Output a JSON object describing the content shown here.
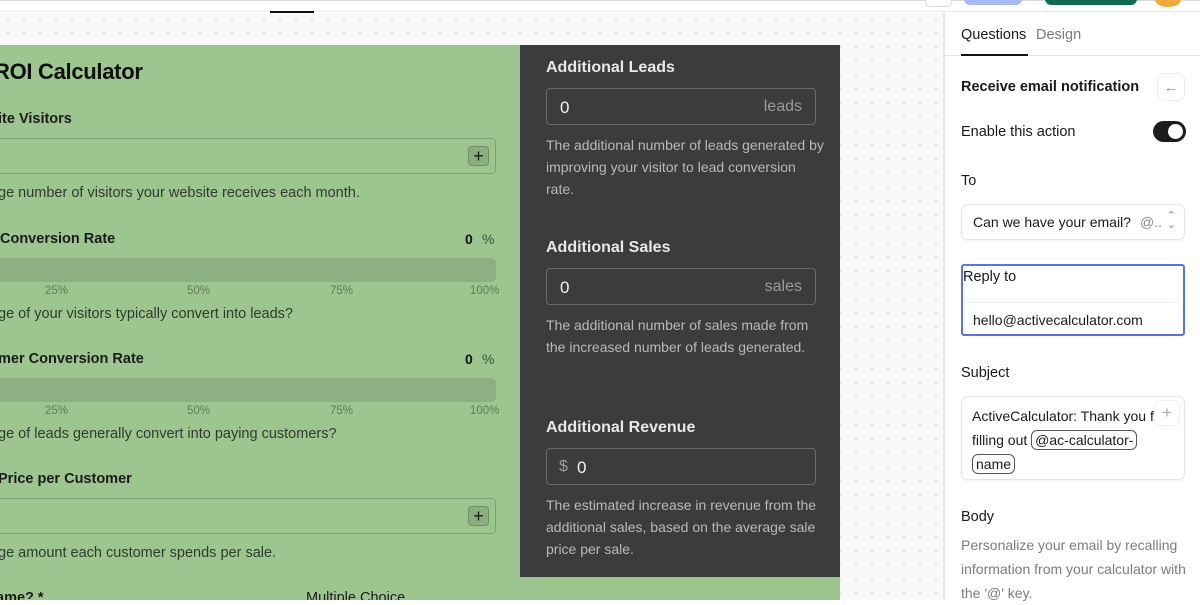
{
  "app": {
    "top_tabs_active_indicator": true
  },
  "calculator": {
    "title": "ROI Calculator",
    "fields": [
      {
        "label": "Website Visitors",
        "description": "Average number of visitors your website receives each month.",
        "increment_icon": "plus-icon"
      },
      {
        "label": "Visitor Conversion Rate",
        "value": "0",
        "unit": "%",
        "progress_fraction": 0,
        "ticks": [
          "25%",
          "50%",
          "75%",
          "100%"
        ],
        "description": "What percentage of your visitors typically convert into leads?"
      },
      {
        "label": "Customer Conversion Rate",
        "value": "0",
        "unit": "%",
        "progress_fraction": 0,
        "ticks": [
          "25%",
          "50%",
          "75%",
          "100%"
        ],
        "description": "What percentage of leads generally convert into paying customers?"
      },
      {
        "label": "Average Price per Customer",
        "description": "Average amount each customer spends per sale.",
        "increment_icon": "plus-icon"
      }
    ],
    "partial_bottom": {
      "question": "name? *",
      "type": "Multiple Choice"
    },
    "visible_fragments": {
      "title": "ROI Calculator",
      "f0_label": "ite Visitors",
      "f0_desc": "ge number of visitors your website receives each month.",
      "f1_label": " Conversion Rate",
      "f1_desc": "ge of your visitors typically convert into leads?",
      "f2_label": "mer Conversion Rate",
      "f2_desc": "ge of leads generally convert into paying customers?",
      "f3_label": "Price per Customer",
      "f3_desc": "ge amount each customer spends per sale.",
      "bottom_q": "ame? *",
      "bottom_type": "Multiple Choice"
    },
    "results": [
      {
        "label": "Additional Leads",
        "value": "0",
        "unit": "leads",
        "description": "The additional number of leads generated by improving your visitor to lead conversion rate."
      },
      {
        "label": "Additional Sales",
        "value": "0",
        "unit": "sales",
        "description": "The additional number of sales made from the increased number of leads generated."
      },
      {
        "label": "Additional Revenue",
        "prefix": "$",
        "value": "0",
        "description": "The estimated increase in revenue from the additional sales, based on the average sale price per sale."
      }
    ],
    "colors": {
      "form_bg": "#9dc590",
      "results_bg": "#3c3c3c"
    }
  },
  "panel": {
    "tabs": [
      {
        "label": "Questions",
        "active": true
      },
      {
        "label": "Design",
        "active": false
      }
    ],
    "section_title": "Receive email notification",
    "back_icon": "arrow-left-icon",
    "enable_label": "Enable this action",
    "enable_on": true,
    "to_label": "To",
    "to_value": "Can we have your email?",
    "to_tag": "@..",
    "reply_label": "Reply to",
    "reply_value": "hello@activecalculator.com",
    "subject_label": "Subject",
    "subject_text": "ActiveCalculator: Thank you for filling out ",
    "subject_chip": "@ac-calculator-name",
    "subject_chip_part1": "@ac-calculator-",
    "subject_chip_part2": "name",
    "body_label": "Body",
    "body_description": "Personalize your email by recalling information from your calculator with the '@' key.",
    "accent_color": "#5872ee"
  }
}
